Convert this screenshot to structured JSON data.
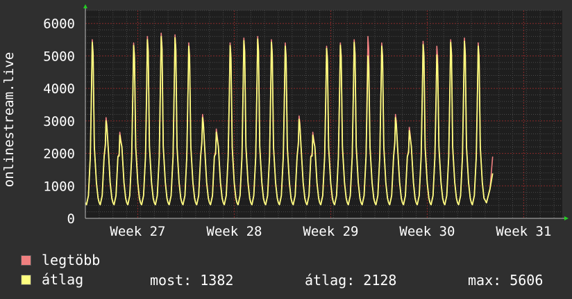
{
  "chart_data": {
    "type": "line",
    "title": "",
    "xlabel": "",
    "ylabel": "onlinestream.live",
    "ylim": [
      0,
      6400
    ],
    "y_ticks": [
      0,
      1000,
      2000,
      3000,
      4000,
      5000,
      6000
    ],
    "y_tick_labels": [
      "0",
      "1000",
      "2000",
      "3000",
      "4000",
      "5000",
      "6000"
    ],
    "x_tick_labels": [
      "Week 27",
      "Week 28",
      "Week 29",
      "Week 30",
      "Week 31"
    ],
    "x_range_days": [
      0,
      34.6
    ],
    "x_tick_days": [
      3.8,
      10.8,
      17.8,
      24.8,
      31.8
    ],
    "grid": true,
    "series": [
      {
        "name": "legtöbb",
        "color": "#f08080",
        "daily_peaks": [
          5500,
          3100,
          2650,
          5400,
          5600,
          5700,
          5650,
          5400,
          3200,
          2750,
          5400,
          5550,
          5600,
          5500,
          5400,
          3150,
          2650,
          5300,
          5400,
          5500,
          5600,
          5400,
          3200,
          2800,
          5450,
          5300,
          5500,
          5550,
          5400
        ],
        "last": 1900
      },
      {
        "name": "átlag",
        "color": "#ffff80",
        "daily_peaks": [
          5420,
          3000,
          2560,
          5320,
          5500,
          5600,
          5560,
          5300,
          3100,
          2650,
          5320,
          5470,
          5520,
          5420,
          5300,
          3050,
          2560,
          5230,
          5330,
          5420,
          5000,
          5300,
          3100,
          2700,
          5350,
          5030,
          5420,
          5450,
          5300
        ],
        "last": 1382
      }
    ]
  },
  "legend": {
    "items": [
      {
        "label": "legtöbb",
        "color": "#f08080"
      },
      {
        "label": "átlag",
        "color": "#ffff80"
      }
    ],
    "stats": {
      "most": "most: 1382",
      "atlag": "átlag: 2128",
      "max": "max: 5606"
    }
  },
  "colors": {
    "background": "#2f2f2f",
    "plot_background": "#1e1e1e",
    "grid_major": "#8a2a2a",
    "grid_minor": "#4a4a4a",
    "axis": "#bbbbbb",
    "arrow": "#22cc22"
  }
}
